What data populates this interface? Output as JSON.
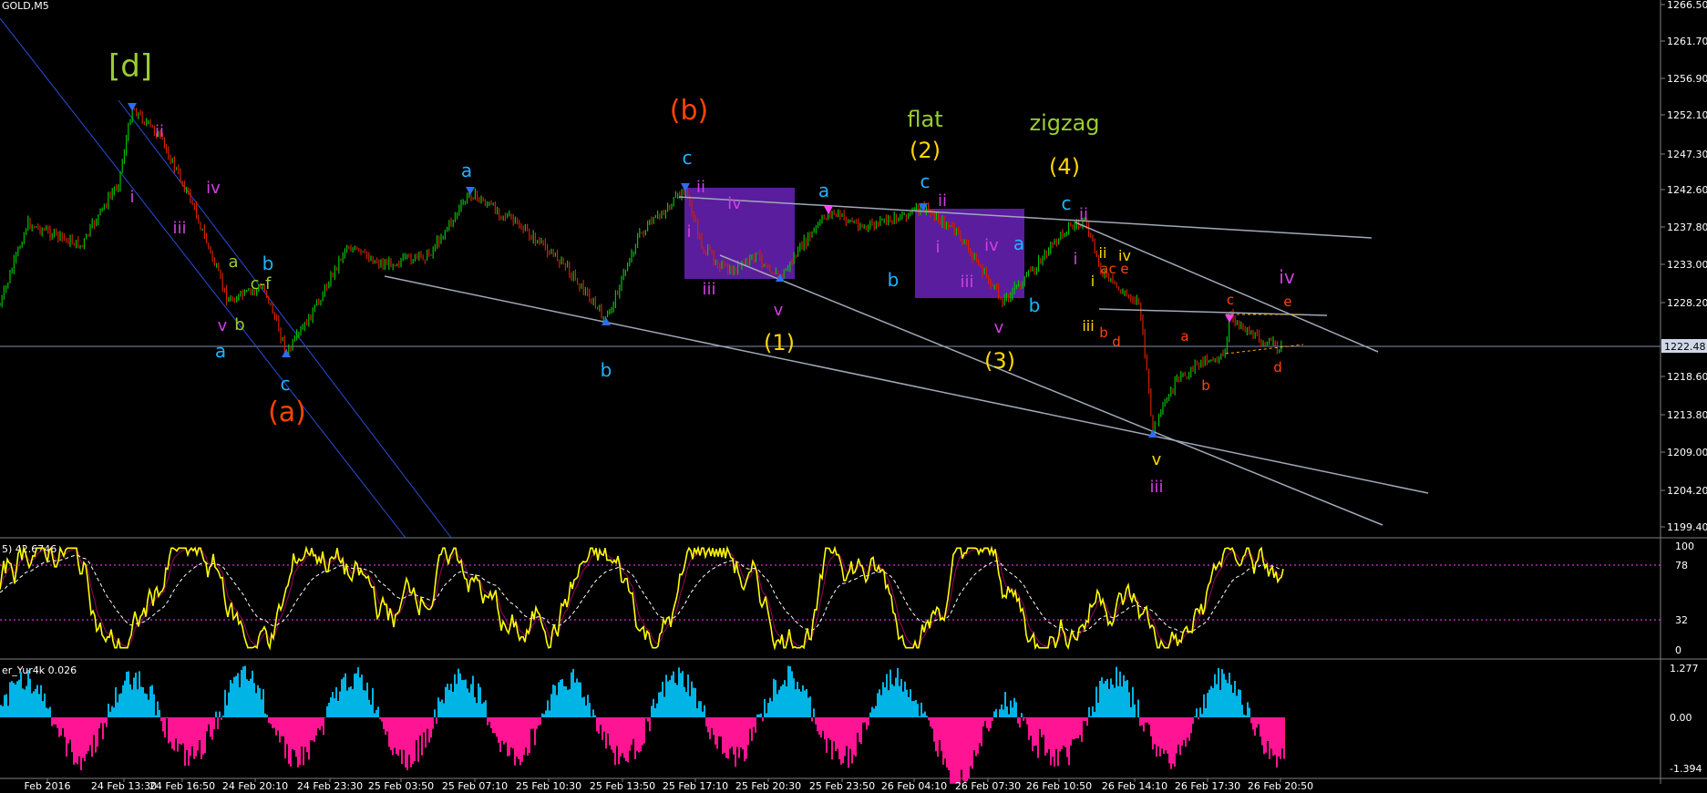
{
  "symbol_title": "GOLD,M5",
  "price_axis": {
    "ticks": [
      "1266.50",
      "1261.70",
      "1256.90",
      "1252.10",
      "1247.30",
      "1242.60",
      "1237.80",
      "1233.00",
      "1228.20",
      "1222.48",
      "1218.60",
      "1213.80",
      "1209.00",
      "1204.20",
      "1199.40"
    ],
    "current_price": "1222.48"
  },
  "time_axis": {
    "ticks": [
      "Feb 2016",
      "24 Feb 13:30",
      "24 Feb 16:50",
      "24 Feb 20:10",
      "24 Feb 23:30",
      "25 Feb 03:50",
      "25 Feb 07:10",
      "25 Feb 10:30",
      "25 Feb 13:50",
      "25 Feb 17:10",
      "25 Feb 20:30",
      "25 Feb 23:50",
      "26 Feb 04:10",
      "26 Feb 07:30",
      "26 Feb 10:50",
      "26 Feb 14:10",
      "26 Feb 17:30",
      "26 Feb 20:50"
    ]
  },
  "stochastic_panel": {
    "header": "5) 42.6746",
    "levels": [
      "100",
      "78",
      "32",
      "0"
    ]
  },
  "oscillator_panel": {
    "header": "er_Yur4k 0.026",
    "levels": [
      "1.277",
      "0.00",
      "-1.394"
    ]
  },
  "wave_labels": {
    "d_bracket": "[d]",
    "b_paren": "(b)",
    "a_paren": "(a)",
    "flat": "flat",
    "zigzag": "zigzag",
    "w1": "(1)",
    "w2": "(2)",
    "w3": "(3)",
    "w4": "(4)",
    "i": "i",
    "ii": "ii",
    "iii": "iii",
    "iv": "iv",
    "v": "v",
    "a": "a",
    "b": "b",
    "c": "c",
    "d": "d",
    "e": "e",
    "cf": "c-f",
    "ac": "ac"
  },
  "colors": {
    "green_label": "#9acd32",
    "orange_label": "#ff4500",
    "cyan_label": "#1eb4ff",
    "magenta_label": "#d040e0",
    "yellow_label": "#ffd700",
    "stoch_line": "#ffff00",
    "hist_positive": "#00b4e6",
    "hist_negative": "#ff1493",
    "candle_up": "#00c000",
    "candle_down": "#d02000",
    "box": "#6a22b8",
    "trendline": "#a0a8b8",
    "channel": "#2a4ed8"
  }
}
